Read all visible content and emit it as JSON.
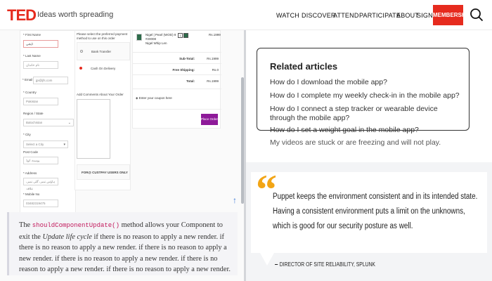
{
  "header": {
    "logo": "TED",
    "tagline": "Ideas worth spreading",
    "nav": [
      "WATCH",
      "DISCOVER",
      "ATTEND",
      "PARTICIPATE",
      "ABOUT",
      "SIGN IN"
    ],
    "membership": "MEMBERSHIP",
    "brand_color": "#e62b1e"
  },
  "checkout": {
    "form_labels": {
      "first_name": "* First Name",
      "last_name": "* Last Name",
      "email": "* Email",
      "country": "* Country",
      "region": "Region / State",
      "city": "* City",
      "post_code": "Post Code",
      "address": "* Address",
      "mobile": "* Mobile No"
    },
    "form_values": {
      "first_name": "ڈیجی",
      "last_name": "نام خاندان",
      "email": "jpi@jfs.com",
      "country": "Pakistan",
      "region": "Balochistan",
      "city": "Select a City",
      "post_code": "پوسٹ کوڈ",
      "address": "ہاؤس نمبر، گلی نمبر، علاقہ",
      "mobile": "03482319475"
    },
    "payment_prompt": "Please select the preferred payment method to use on this order",
    "payment_options": [
      "Bank Transfer",
      "Cash On Delivery"
    ],
    "comments_label": "Add Comments About Your Order",
    "promo_text": "FOR@ CUSTPAY USERS ONLY",
    "coupon_placeholder": "Enter your coupon here",
    "place_order": "Place Order",
    "order": {
      "product_line1": "Nigel | Pearl (WOD) 8",
      "product_line2": "#20008",
      "product_line3": "Nigel Whip Len",
      "qty": "1",
      "price": "Rs.1999",
      "subtotal_label": "Sub-Total:",
      "subtotal": "Rs.1999",
      "shipping_label": "Free Shipping:",
      "shipping": "Rs.0",
      "total_label": "Total:",
      "total": "Rs.1999"
    }
  },
  "note": {
    "prefix": "The",
    "code": "shouldComponentUpdate()",
    "mid": "method allows your Component to exit the",
    "emph": "Update life cycle",
    "rest": "if there is no reason to apply a new render. if there is no reason to apply a new render. if there is no reason to apply a new render. if there is no reason to apply a new render. if there is no reason to apply a new render. if there is no reason to apply a new render."
  },
  "related": {
    "title": "Related articles",
    "links": [
      "How do I download the mobile app?",
      "How do I complete my weekly check-in in the mobile app?",
      "How do I connect a step tracker or wearable device through the mobile app?",
      "How do I set a weight goal in the mobile app?",
      "My videos are stuck or are freezing and will not play."
    ]
  },
  "quote": {
    "text": "Puppet keeps the environment consistent and in its intended state. Having a consistent environment puts a limit on the unknowns, which is good for our security posture as well.",
    "author": "DIRECTOR OF SITE RELIABILITY, SPLUNK",
    "accent_color": "#f2a516"
  }
}
